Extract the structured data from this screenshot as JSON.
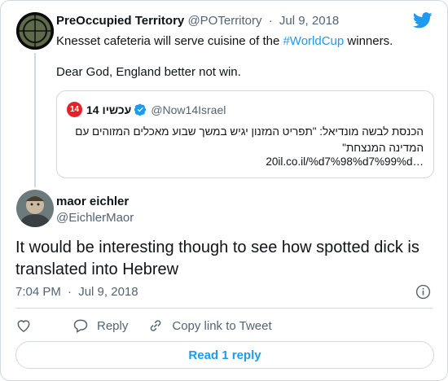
{
  "parent_tweet": {
    "author_name": "PreOccupied Territory",
    "author_handle": "@POTerritory",
    "separator": "·",
    "date": "Jul 9, 2018",
    "text_before_link": "Knesset cafeteria will serve cuisine of the ",
    "hashtag": "#WorldCup",
    "text_after_link": " winners.",
    "text_line2": "Dear God, England better not win."
  },
  "quoted_tweet": {
    "badge": "14",
    "author_name": "עכשיו 14",
    "author_handle": "@Now14Israel",
    "text": "הכנסת לבשה מונדיאל: \"תפריט המזנון יגיש במשך שבוע מאכלים המזוהים עם המדינה המנצחת\"",
    "url": "20il.co.il/%d7%98%d7%99%d…"
  },
  "main_tweet": {
    "author_name": "maor eichler",
    "author_handle": "@EichlerMaor",
    "text": "It would be interesting though to see how spotted dick is translated into Hebrew",
    "time": "7:04 PM",
    "separator": "·",
    "date": "Jul 9, 2018"
  },
  "actions": {
    "reply_label": "Reply",
    "copy_link_label": "Copy link to Tweet"
  },
  "read_replies_label": "Read 1 reply",
  "colors": {
    "accent": "#1d9bf0",
    "muted": "#536471",
    "border": "#cfd9de",
    "badge_red": "#e5202a"
  },
  "icons": [
    "twitter-bird-icon",
    "verified-badge-icon",
    "info-icon",
    "heart-icon",
    "reply-bubble-icon",
    "link-icon"
  ]
}
